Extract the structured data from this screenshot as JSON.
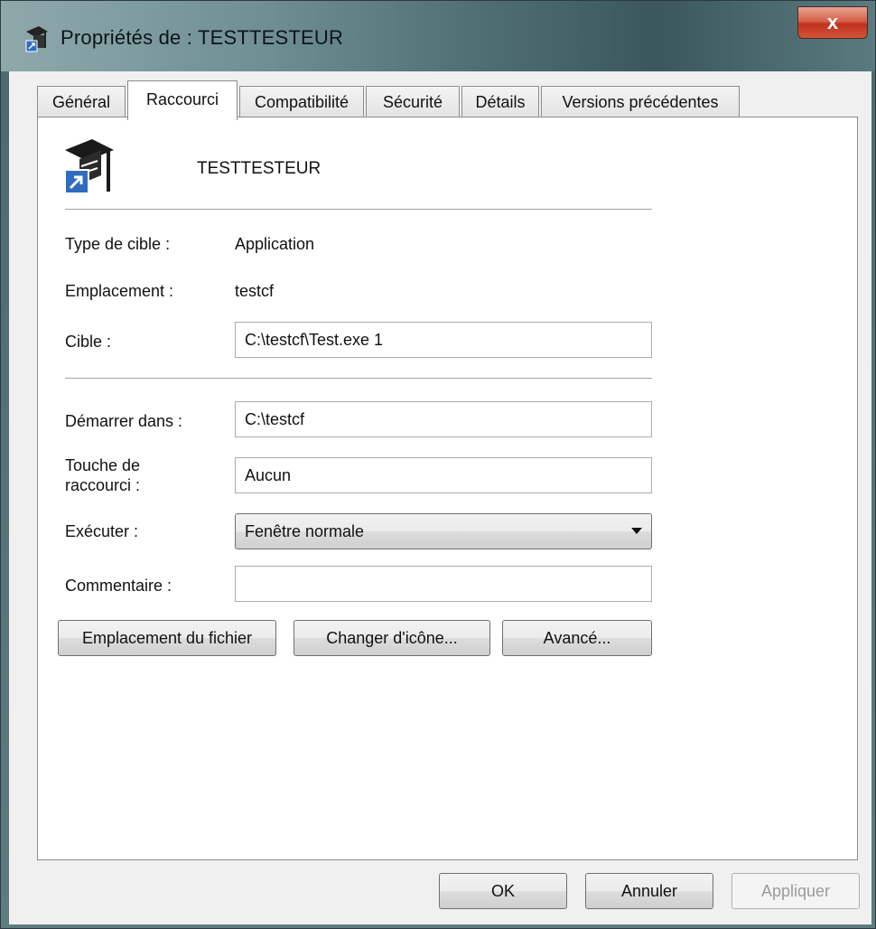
{
  "window": {
    "title": "Propriétés de : TESTTESTEUR",
    "close_label": "x"
  },
  "tabs": [
    {
      "label": "Général"
    },
    {
      "label": "Raccourci",
      "active": true
    },
    {
      "label": "Compatibilité"
    },
    {
      "label": "Sécurité"
    },
    {
      "label": "Détails"
    },
    {
      "label": "Versions précédentes"
    }
  ],
  "shortcut": {
    "name": "TESTTESTEUR",
    "icon": "graduation-cap-shortcut-icon"
  },
  "fields": {
    "target_type": {
      "label": "Type de cible :",
      "value": "Application"
    },
    "location": {
      "label": "Emplacement :",
      "value": "testcf"
    },
    "target": {
      "label": "Cible :",
      "value": "C:\\testcf\\Test.exe 1"
    },
    "start_in": {
      "label": "Démarrer dans :",
      "value": "C:\\testcf"
    },
    "hotkey": {
      "label_line1": "Touche de",
      "label_line2": "raccourci :",
      "value": "Aucun"
    },
    "run": {
      "label": "Exécuter :",
      "value": "Fenêtre normale"
    },
    "comment": {
      "label": "Commentaire :",
      "value": ""
    }
  },
  "buttons": {
    "open_location": "Emplacement du fichier",
    "change_icon": "Changer d'icône...",
    "advanced": "Avancé...",
    "ok": "OK",
    "cancel": "Annuler",
    "apply": "Appliquer"
  }
}
